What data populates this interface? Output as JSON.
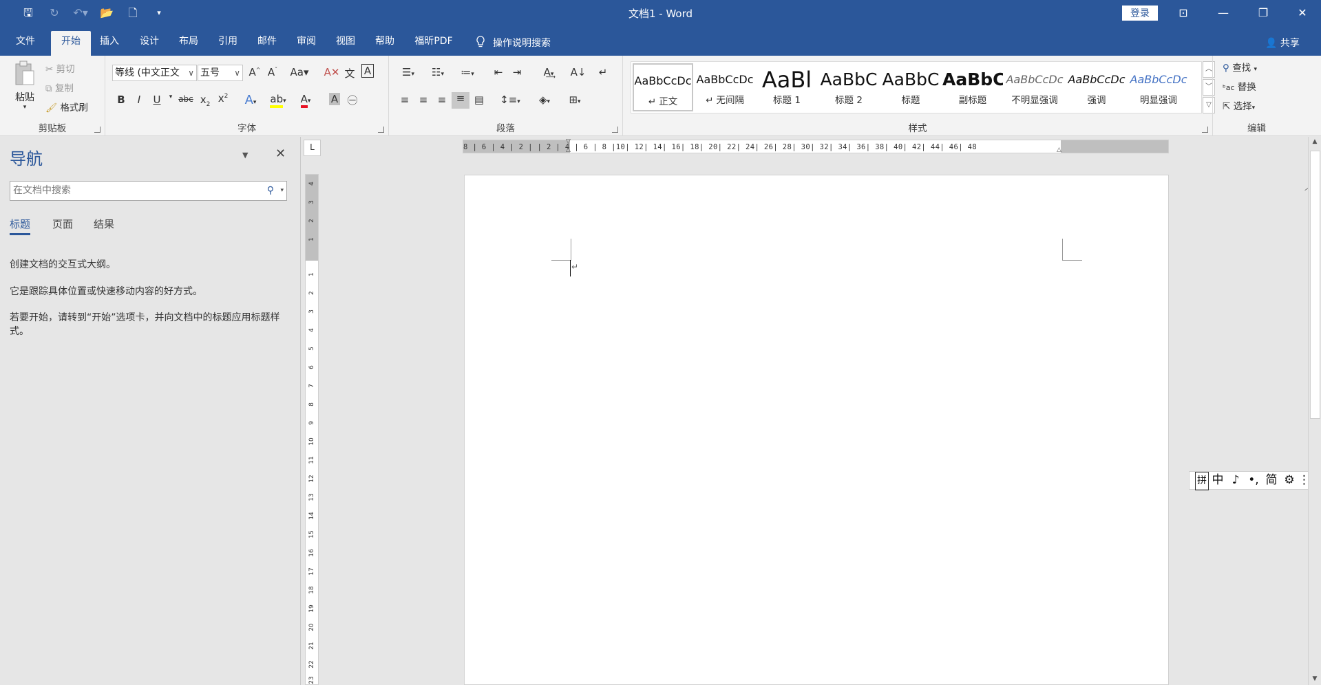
{
  "window": {
    "title": "文档1  -  Word",
    "login_label": "登录"
  },
  "tabs": [
    "文件",
    "开始",
    "插入",
    "设计",
    "布局",
    "引用",
    "邮件",
    "审阅",
    "视图",
    "帮助",
    "福昕PDF"
  ],
  "tell_me": "操作说明搜索",
  "share_label": "共享",
  "clipboard": {
    "paste": "粘贴",
    "cut": "剪切",
    "copy": "复制",
    "format_painter": "格式刷",
    "group_label": "剪贴板"
  },
  "font": {
    "font_name": "等线 (中文正文",
    "font_size": "五号",
    "change_case": "Aa",
    "group_label": "字体"
  },
  "paragraph": {
    "group_label": "段落"
  },
  "styles": {
    "group_label": "样式",
    "items": [
      {
        "sample": "AaBbCcDc",
        "name": "↵ 正文"
      },
      {
        "sample": "AaBbCcDc",
        "name": "↵ 无间隔"
      },
      {
        "sample": "AaBl",
        "name": "标题 1"
      },
      {
        "sample": "AaBbC",
        "name": "标题 2"
      },
      {
        "sample": "AaBbC",
        "name": "标题"
      },
      {
        "sample": "AaBbC",
        "name": "副标题"
      },
      {
        "sample": "AaBbCcDc",
        "name": "不明显强调"
      },
      {
        "sample": "AaBbCcDc",
        "name": "强调"
      },
      {
        "sample": "AaBbCcDc",
        "name": "明显强调"
      }
    ]
  },
  "editing": {
    "find": "查找",
    "replace": "替换",
    "select": "选择",
    "group_label": "编辑"
  },
  "nav": {
    "title": "导航",
    "search_placeholder": "在文档中搜索",
    "tabs": [
      "标题",
      "页面",
      "结果"
    ],
    "text1": "创建文档的交互式大纲。",
    "text2": "它是跟踪具体位置或快速移动内容的好方式。",
    "text3": "若要开始，请转到“开始”选项卡，并向文档中的标题应用标题样式。"
  },
  "ruler": {
    "horizontal": "8 | 6 | 4 | 2 |     | 2 | 4 | 6 | 8 |10| 12| 14| 16| 18| 20| 22| 24| 26| 28| 30| 32| 34| 36| 38| 40| 42| 44| 46| 48",
    "vertical_top": [
      "4",
      "3",
      "2",
      "1"
    ],
    "vertical": [
      "1",
      "2",
      "3",
      "4",
      "5",
      "6",
      "7",
      "8",
      "9",
      "10",
      "11",
      "12",
      "13",
      "14",
      "15",
      "16",
      "17",
      "18",
      "19",
      "20",
      "21",
      "22",
      "23"
    ],
    "corner": "L"
  },
  "ime": {
    "items": [
      "拼",
      "中",
      "♪",
      "•,",
      "简",
      "⚙",
      "⋮"
    ]
  },
  "colors": {
    "brand": "#2b579a",
    "font_color": "#e81123",
    "highlight": "#ffff00"
  }
}
